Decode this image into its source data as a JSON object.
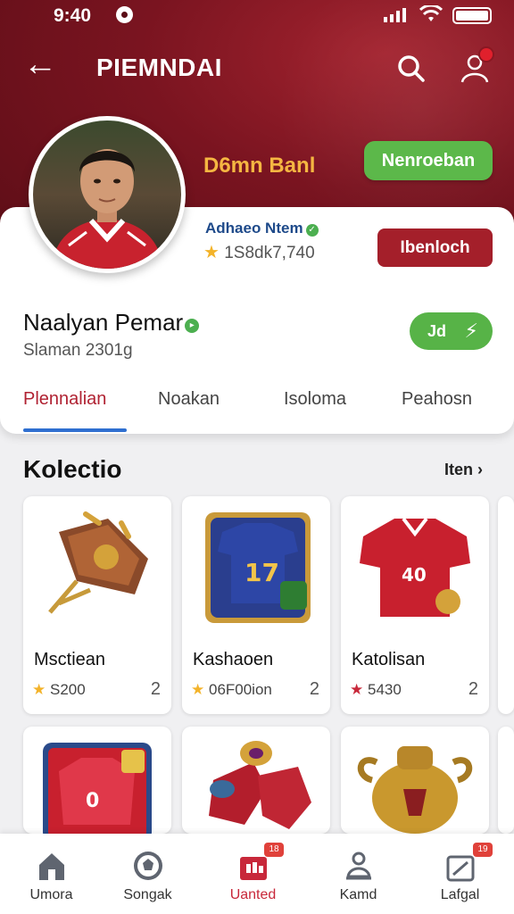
{
  "status_bar": {
    "time": "9:40"
  },
  "header": {
    "title": "PIEMNDAI"
  },
  "profile": {
    "display_name": "D6mn Banl",
    "top_button": "Nenroeban",
    "verified_name": "Adhaeo Ntem",
    "rating": "1S8dk7,740",
    "action_button": "Ibenloch",
    "username": "Naalyan Pemar",
    "subtitle": "Slaman 2301g",
    "pill_button": "Jd"
  },
  "tabs": [
    {
      "label": "Plennalian"
    },
    {
      "label": "Noakan"
    },
    {
      "label": "Isoloma"
    },
    {
      "label": "Peahosn"
    }
  ],
  "collection": {
    "title": "Kolectio",
    "see_all": "Iten",
    "items": [
      {
        "name": "Msctiean",
        "price": "S200",
        "count": "2"
      },
      {
        "name": "Kashaoen",
        "price": "06F00ion",
        "count": "2"
      },
      {
        "name": "Katolisan",
        "price": "5430",
        "count": "2"
      }
    ]
  },
  "bottom_nav": [
    {
      "label": "Umora",
      "icon": "home-icon"
    },
    {
      "label": "Songak",
      "icon": "soccer-ball-icon"
    },
    {
      "label": "Uanted",
      "icon": "shop-icon",
      "badge": "18"
    },
    {
      "label": "Kamd",
      "icon": "bell-icon"
    },
    {
      "label": "Lafgal",
      "icon": "calendar-icon",
      "badge": "19"
    }
  ],
  "colors": {
    "brand_red": "#a41f2a",
    "accent_green": "#5cb84a",
    "gold": "#f5b642",
    "tab_active": "#b02232",
    "underline_blue": "#2f6fd0"
  }
}
